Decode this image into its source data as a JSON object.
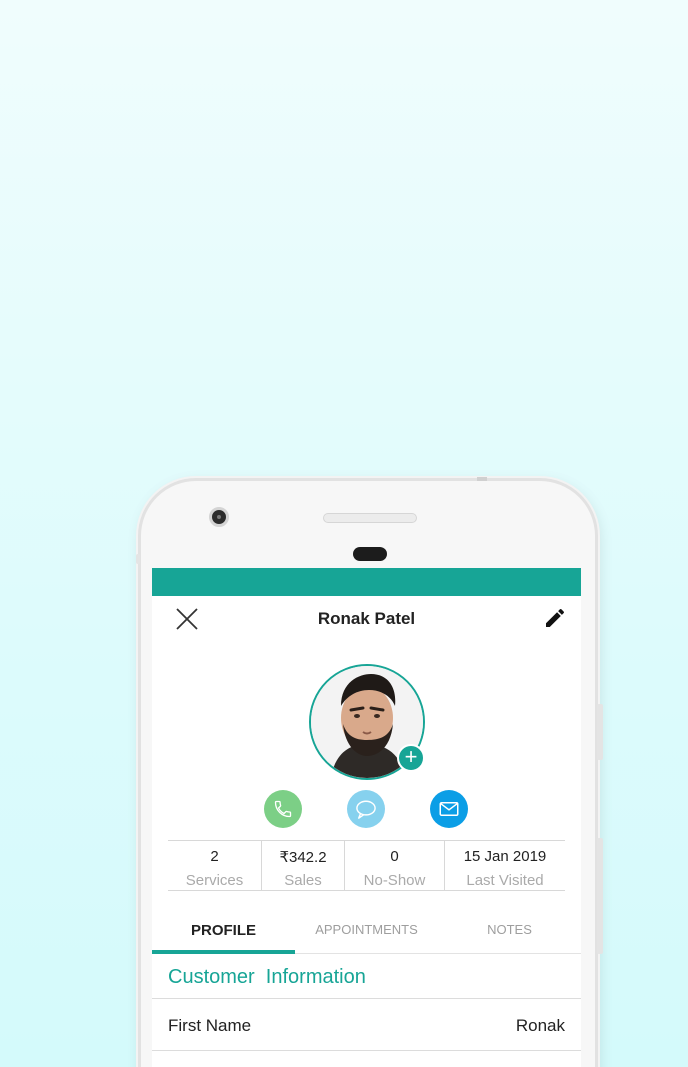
{
  "header": {
    "title": "Ronak Patel"
  },
  "colors": {
    "accent": "#17a596",
    "call": "#7ccf86",
    "message": "#86d1ee",
    "email": "#0b9ee6"
  },
  "icons": {
    "close": "close-icon",
    "edit": "pencil-icon",
    "add_photo": "plus-icon",
    "call": "phone-icon",
    "message": "chat-bubble-icon",
    "email": "envelope-icon"
  },
  "stats": [
    {
      "value": "2",
      "label": "Services"
    },
    {
      "value": "₹342.2",
      "label": "Sales"
    },
    {
      "value": "0",
      "label": "No-Show"
    },
    {
      "value": "15 Jan 2019",
      "label": "Last Visited"
    }
  ],
  "tabs": [
    {
      "label": "PROFILE",
      "active": true
    },
    {
      "label": "APPOINTMENTS",
      "active": false
    },
    {
      "label": "NOTES",
      "active": false
    }
  ],
  "section": {
    "title": "Customer  Information"
  },
  "fields": [
    {
      "label": "First Name",
      "value": "Ronak"
    }
  ]
}
